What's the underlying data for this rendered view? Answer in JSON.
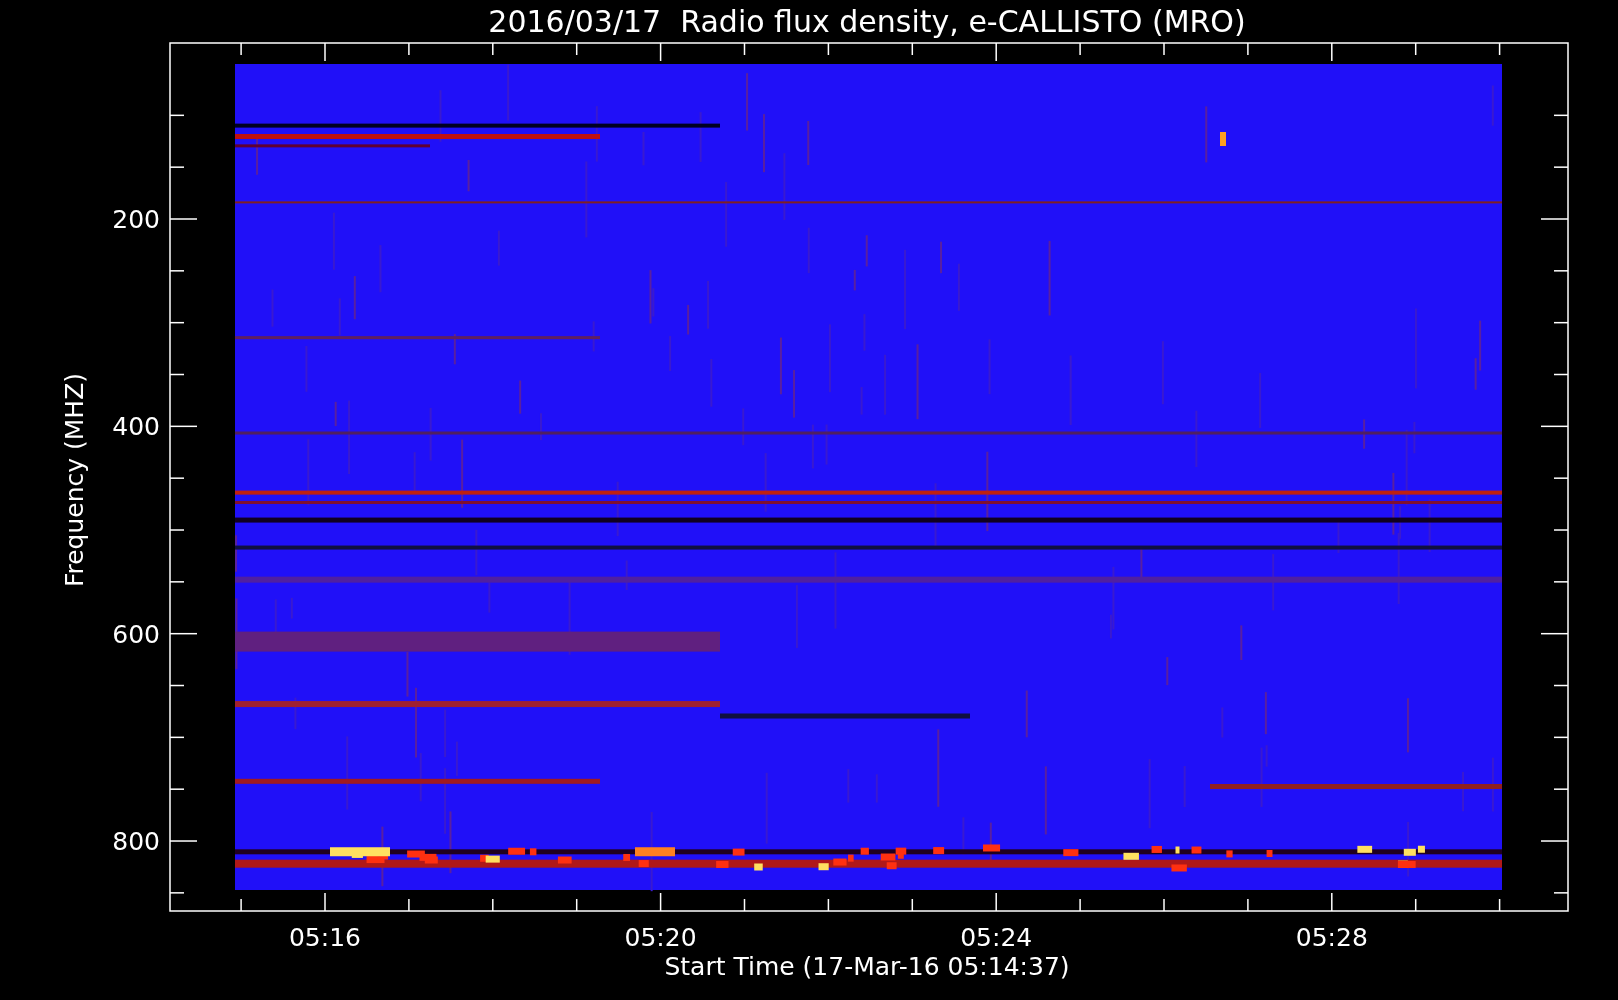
{
  "title": "2016/03/17  Radio flux density, e-CALLISTO (MRO)",
  "y_axis": {
    "label": "Frequency (MHZ)",
    "ticks": [
      "200",
      "400",
      "600",
      "800"
    ]
  },
  "x_axis": {
    "label": "Start Time (17-Mar-16 05:14:37)",
    "ticks": [
      "05:16",
      "05:20",
      "05:24",
      "05:28"
    ]
  }
}
